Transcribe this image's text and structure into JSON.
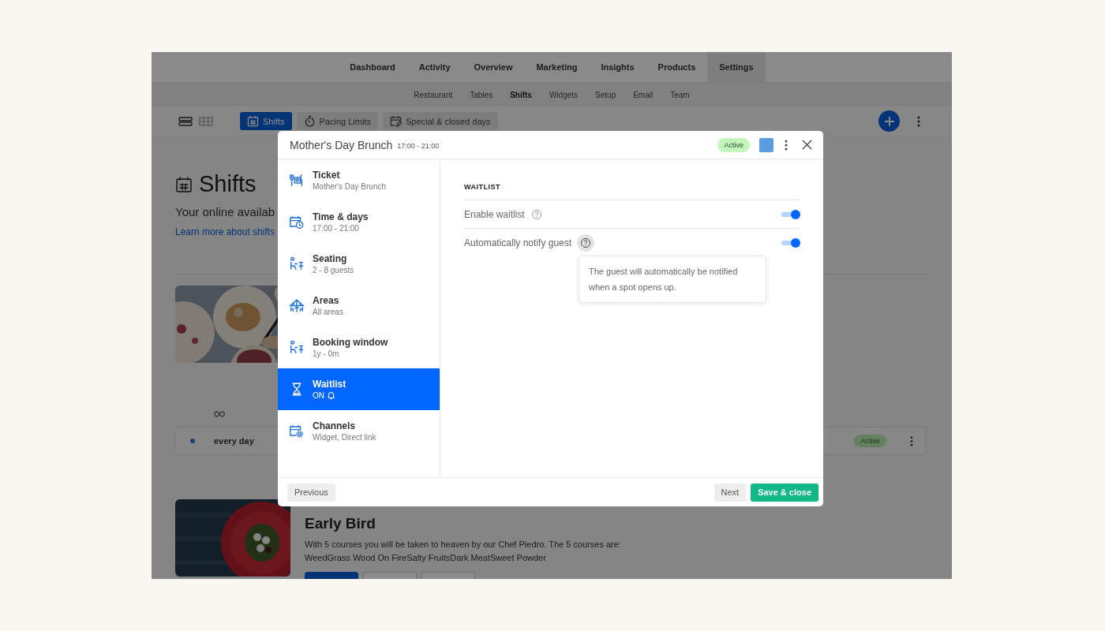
{
  "nav": {
    "tabs": [
      {
        "label": "Dashboard",
        "selected": false
      },
      {
        "label": "Activity",
        "selected": false
      },
      {
        "label": "Overview",
        "selected": false
      },
      {
        "label": "Marketing",
        "selected": false
      },
      {
        "label": "Insights",
        "selected": false
      },
      {
        "label": "Products",
        "selected": false
      },
      {
        "label": "Settings",
        "selected": true
      }
    ]
  },
  "subnav": {
    "tabs": [
      {
        "label": "Restaurant",
        "selected": false
      },
      {
        "label": "Tables",
        "selected": false
      },
      {
        "label": "Shifts",
        "selected": true
      },
      {
        "label": "Widgets",
        "selected": false
      },
      {
        "label": "Setup",
        "selected": false
      },
      {
        "label": "Email",
        "selected": false
      },
      {
        "label": "Team",
        "selected": false
      }
    ]
  },
  "toolbar": {
    "views": [
      {
        "kind": "list",
        "selected": true
      },
      {
        "kind": "grid",
        "selected": false
      }
    ],
    "tabs": [
      {
        "label": "Shifts",
        "kind": "calendar",
        "selected": true
      },
      {
        "label": "Pacing Limits",
        "kind": "stopwatch",
        "selected": false
      },
      {
        "label": "Special & closed days",
        "kind": "calendar-edit",
        "selected": false
      }
    ]
  },
  "page": {
    "title": "Shifts",
    "subtitle": "Your online availab",
    "link": "Learn more about shifts"
  },
  "shift_row": {
    "schedule": "every day",
    "status": "Active"
  },
  "offer": {
    "title": "Early Bird",
    "description": "With 5 courses you will be taken to heaven by our Chef Piedro. The 5 courses are:",
    "courses": "WeedGrass Wood On FireSalty FruitsDark MeatSweet Powder"
  },
  "modal": {
    "title": "Mother's Day Brunch",
    "time": "17:00 - 21:00",
    "status": "Active",
    "color": "#5b9be0",
    "sections": [
      {
        "kind": "ticket",
        "title": "Ticket",
        "subtitle": "Mother's Day Brunch",
        "bell": false,
        "selected": false
      },
      {
        "kind": "calendar-clock",
        "title": "Time & days",
        "subtitle": "17:00 - 21:00",
        "bell": false,
        "selected": false
      },
      {
        "kind": "seating",
        "title": "Seating",
        "subtitle": "2 - 8 guests",
        "bell": false,
        "selected": false
      },
      {
        "kind": "umbrella",
        "title": "Areas",
        "subtitle": "All areas",
        "bell": false,
        "selected": false
      },
      {
        "kind": "seating",
        "title": "Booking window",
        "subtitle": "1y - 0m",
        "bell": false,
        "selected": false
      },
      {
        "kind": "hourglass",
        "title": "Waitlist",
        "subtitle": "ON",
        "bell": true,
        "selected": true
      },
      {
        "kind": "calendar-gear",
        "title": "Channels",
        "subtitle": "Widget, Direct link",
        "bell": false,
        "selected": false
      }
    ],
    "panel": {
      "heading": "WAITLIST",
      "settings": [
        {
          "label": "Enable waitlist",
          "on": true
        },
        {
          "label": "Automatically notify guest",
          "on": true,
          "tooltip": "The guest will automatically be notified when a spot opens up."
        }
      ]
    },
    "buttons": {
      "previous": "Previous",
      "next": "Next",
      "save": "Save & close"
    }
  }
}
